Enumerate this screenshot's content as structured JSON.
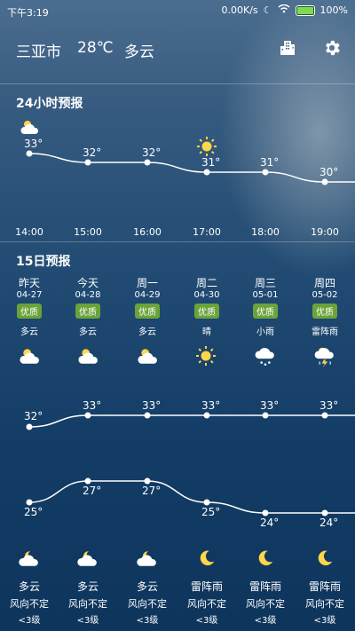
{
  "status": {
    "time": "下午3:19",
    "speed": "0.00K/s",
    "battery": "100%"
  },
  "header": {
    "city": "三亚市",
    "temp": "28℃",
    "condition": "多云"
  },
  "hourly": {
    "title": "24小时预报",
    "items": [
      {
        "time": "14:00",
        "temp": "33°",
        "icon": "cloudy-day-icon"
      },
      {
        "time": "15:00",
        "temp": "32°",
        "icon": ""
      },
      {
        "time": "16:00",
        "temp": "32°",
        "icon": ""
      },
      {
        "time": "17:00",
        "temp": "31°",
        "icon": "sun-icon"
      },
      {
        "time": "18:00",
        "temp": "31°",
        "icon": ""
      },
      {
        "time": "19:00",
        "temp": "30°",
        "icon": ""
      }
    ]
  },
  "daily": {
    "title": "15日预报",
    "days": [
      {
        "day": "昨天",
        "date": "04-27",
        "aqi": "优质",
        "cond_day": "多云",
        "high": "32°",
        "low": "25°",
        "cond_night": "多云",
        "wind": "风向不定",
        "level": "<3级"
      },
      {
        "day": "今天",
        "date": "04-28",
        "aqi": "优质",
        "cond_day": "多云",
        "high": "33°",
        "low": "27°",
        "cond_night": "多云",
        "wind": "风向不定",
        "level": "<3级"
      },
      {
        "day": "周一",
        "date": "04-29",
        "aqi": "优质",
        "cond_day": "多云",
        "high": "33°",
        "low": "27°",
        "cond_night": "多云",
        "wind": "风向不定",
        "level": "<3级"
      },
      {
        "day": "周二",
        "date": "04-30",
        "aqi": "优质",
        "cond_day": "晴",
        "high": "33°",
        "low": "25°",
        "cond_night": "雷阵雨",
        "wind": "风向不定",
        "level": "<3级"
      },
      {
        "day": "周三",
        "date": "05-01",
        "aqi": "优质",
        "cond_day": "小雨",
        "high": "33°",
        "low": "24°",
        "cond_night": "雷阵雨",
        "wind": "风向不定",
        "level": "<3级"
      },
      {
        "day": "周四",
        "date": "05-02",
        "aqi": "优质",
        "cond_day": "雷阵雨",
        "high": "33°",
        "low": "24°",
        "cond_night": "雷阵雨",
        "wind": "风向不定",
        "level": "<3级"
      }
    ]
  }
}
